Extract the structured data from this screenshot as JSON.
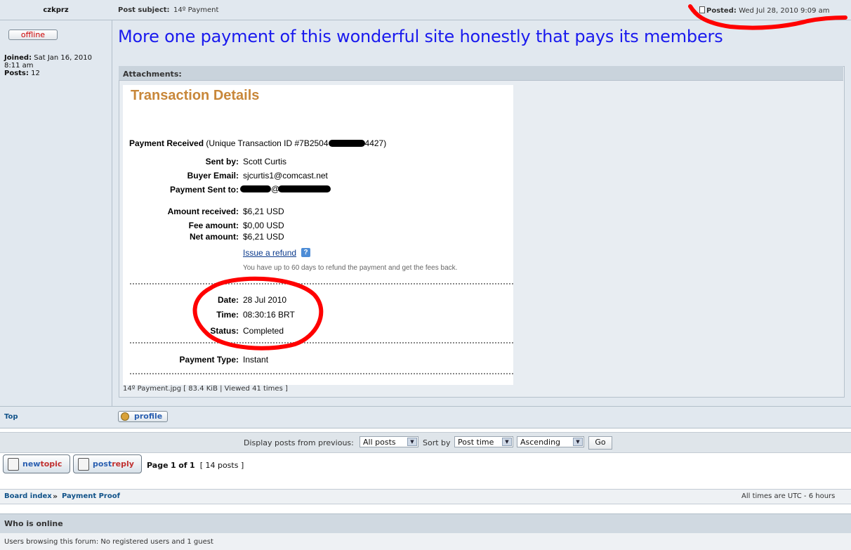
{
  "post": {
    "author": "czkprz",
    "status_button": "offline",
    "joined_label": "Joined:",
    "joined_value": "Sat Jan 16, 2010",
    "joined_time": "8:11 am",
    "posts_label": "Posts:",
    "posts_value": "12",
    "subject_label": "Post subject:",
    "subject_value": "14º Payment",
    "posted_label": "Posted:",
    "posted_value": "Wed Jul 28, 2010 9:09 am",
    "body": "More one payment of this wonderful site honestly that pays its members",
    "attachments_label": "Attachments:",
    "attachment_file": "14º Payment.jpg [ 83.4 KiB | Viewed 41 times ]",
    "top_link": "Top",
    "profile_button": "profile"
  },
  "transaction": {
    "title": "Transaction Details",
    "payment_received_label": "Payment Received",
    "payment_received_prefix": "(Unique Transaction ID #7B2504",
    "payment_received_suffix": "4427)",
    "sent_by_label": "Sent by:",
    "sent_by_value": "Scott Curtis",
    "buyer_email_label": "Buyer Email:",
    "buyer_email_value": "sjcurtis1@comcast.net",
    "payment_sent_to_label": "Payment Sent to:",
    "payment_sent_to_at": "@",
    "amount_received_label": "Amount received:",
    "amount_received_value": "$6,21 USD",
    "fee_amount_label": "Fee amount:",
    "fee_amount_value": "$0,00 USD",
    "net_amount_label": "Net amount:",
    "net_amount_value": "$6,21 USD",
    "refund_link": "Issue a refund",
    "refund_note": "You have up to 60 days to refund the payment and get the fees back.",
    "date_label": "Date:",
    "date_value": "28 Jul 2010",
    "time_label": "Time:",
    "time_value": "08:30:16 BRT",
    "status_label": "Status:",
    "status_value": "Completed",
    "payment_type_label": "Payment Type:",
    "payment_type_value": "Instant"
  },
  "display": {
    "label": "Display posts from previous:",
    "posts_select": "All posts",
    "sort_label": "Sort by",
    "sort_select": "Post time",
    "order_select": "Ascending",
    "go_button": "Go"
  },
  "actions": {
    "new_topic_a": "new",
    "new_topic_b": "topic",
    "post_reply_a": "post",
    "post_reply_b": "reply",
    "page_text_a": "Page",
    "page_text_b": "1",
    "page_text_c": "of",
    "page_text_d": "1",
    "post_count": "[ 14 posts ]"
  },
  "nav": {
    "board_index": "Board index",
    "separator": "»",
    "forum": "Payment Proof",
    "timezone": "All times are UTC - 6 hours"
  },
  "online": {
    "title": "Who is online",
    "text": "Users browsing this forum: No registered users and 1 guest"
  },
  "colors": {
    "accent_red_marker": "#ff0000",
    "body_text_blue": "#1a1aee",
    "link_blue": "#105289",
    "transaction_title": "#c8873a"
  },
  "icons": [
    "post-icon",
    "help-icon",
    "profile-icon",
    "new-topic-icon",
    "post-reply-icon",
    "dropdown-arrow-icon"
  ]
}
